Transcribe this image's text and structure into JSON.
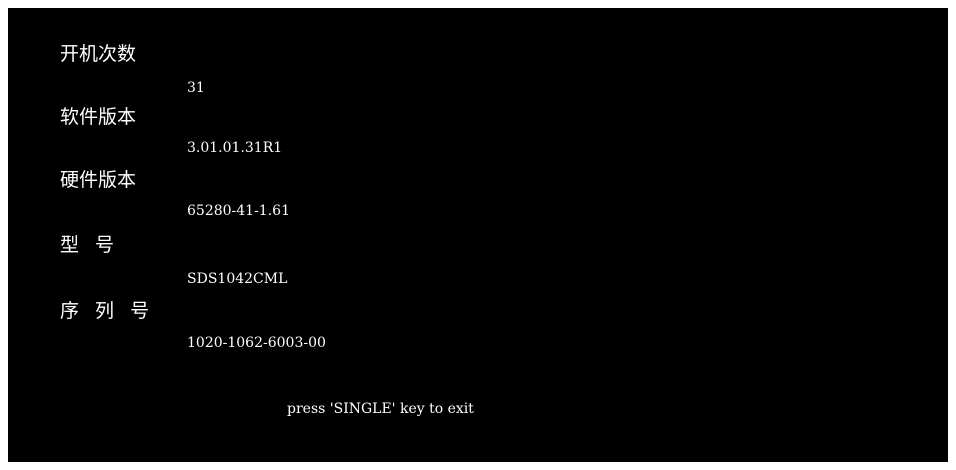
{
  "info": {
    "boot_count": {
      "label": "开机次数",
      "value": "31"
    },
    "software_version": {
      "label": "软件版本",
      "value": "3.01.01.31R1"
    },
    "hardware_version": {
      "label": "硬件版本",
      "value": "65280-41-1.61"
    },
    "model": {
      "label": "型 号",
      "value": "SDS1042CML"
    },
    "serial_number": {
      "label": "序 列 号",
      "value": "1020-1062-6003-00"
    }
  },
  "footer": {
    "exit_hint": "press 'SINGLE' key to exit"
  },
  "colors": {
    "background": "#000000",
    "text": "#ffffff"
  }
}
